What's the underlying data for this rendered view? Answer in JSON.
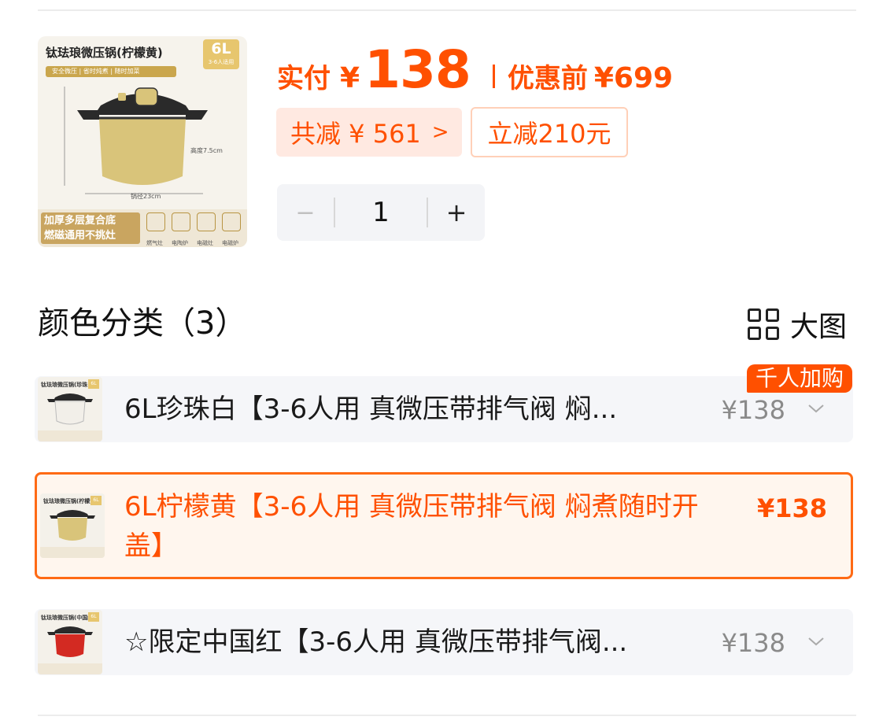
{
  "product": {
    "thumb_title": "钛珐琅微压锅(柠檬黄)",
    "thumb_volume": "6L",
    "thumb_volume_sub": "3-6人适用",
    "thumb_tags": "安全微压 | 省时炖煮 | 随时加菜",
    "thumb_dim_height": "高度7.5cm",
    "thumb_dim_width": "锅径23cm",
    "thumb_feature_line1": "加厚多层复合底",
    "thumb_feature_line2": "燃磁通用不挑灶",
    "thumb_icon_labels": [
      "燃气灶",
      "电陶炉",
      "电磁灶",
      "电磁炉"
    ],
    "pot_color": "#d9c47a"
  },
  "price": {
    "paid_label": "实付",
    "currency": "¥",
    "paid_amount": "138",
    "original_label": "优惠前",
    "original_price": "¥699",
    "total_discount": "共减 ¥ 561",
    "discount_chevron": ">",
    "instant_discount": "立减210元",
    "accent_color": "#ff5000"
  },
  "stepper": {
    "minus": "−",
    "quantity": "1",
    "plus": "+"
  },
  "section": {
    "title": "颜色分类（3）",
    "view_toggle_label": "大图"
  },
  "options": [
    {
      "name": "6L珍珠白【3-6人用 真微压带排气阀 焖...",
      "price": "¥138",
      "thumb_title": "钛珐琅微压锅(珍珠白)",
      "thumb_vol": "6L",
      "pot_color": "#f2efe9",
      "selected": false
    },
    {
      "name": "6L柠檬黄【3-6人用 真微压带排气阀 焖煮随时开盖】",
      "price": "¥138",
      "thumb_title": "钛珐琅微压锅(柠檬黄)",
      "thumb_vol": "6L",
      "pot_color": "#d9c47a",
      "selected": true
    },
    {
      "name": "☆限定中国红【3-6人用 真微压带排气阀...",
      "price": "¥138",
      "thumb_title": "钛珐琅微压锅(中国红)",
      "thumb_vol": "6L",
      "pot_color": "#d32a22",
      "selected": false
    }
  ],
  "hot_badge": "千人加购"
}
